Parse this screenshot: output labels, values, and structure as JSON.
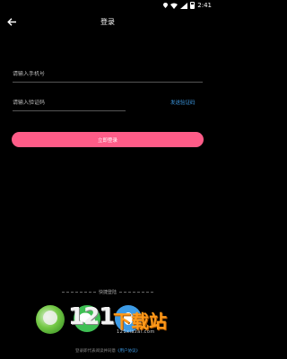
{
  "status_bar": {
    "time": "2:41"
  },
  "header": {
    "title": "登录"
  },
  "form": {
    "phone_placeholder": "请输入手机号",
    "code_placeholder": "请输入验证码",
    "send_code_label": "发送验证码",
    "login_label": "立即登录"
  },
  "quick_login": {
    "label": "快捷登陆"
  },
  "watermark": {
    "digits": "121",
    "text": "下载站",
    "url": "121xiazai.com"
  },
  "agreement": {
    "prefix": "登录即代表阅读并同意",
    "link": "《用户协议》"
  },
  "colors": {
    "accent_pink": "#ff5c88",
    "link_blue": "#3d9be6",
    "wechat_green": "#3fbf54",
    "background": "#000000"
  },
  "icons": {
    "back": "arrow-left-icon",
    "wechat": "wechat-icon",
    "qq": "qq-icon"
  }
}
